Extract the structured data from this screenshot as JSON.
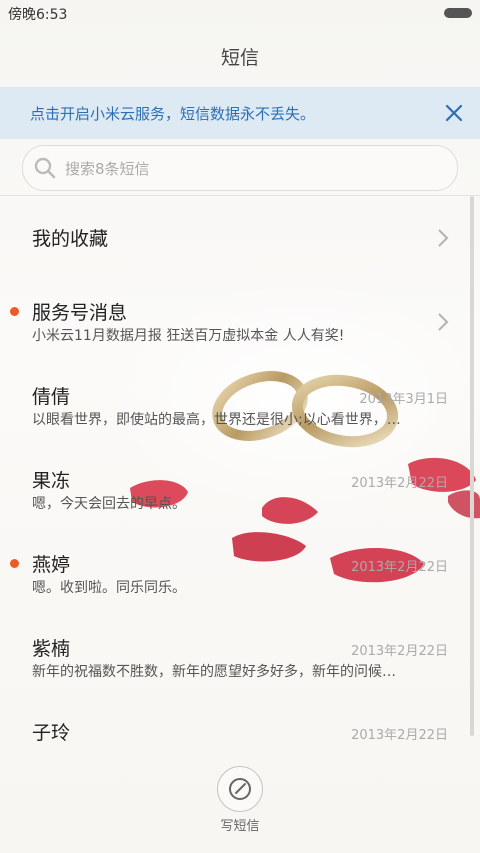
{
  "status_bar": {
    "time": "傍晚6:53"
  },
  "header": {
    "title": "短信"
  },
  "cloud_banner": {
    "text": "点击开启小米云服务，短信数据永不丢失。"
  },
  "search": {
    "placeholder": "搜索8条短信"
  },
  "conversations": [
    {
      "name": "我的收藏",
      "preview": "",
      "date": "",
      "unread": false,
      "chevron": true
    },
    {
      "name": "服务号消息",
      "preview": "小米云11月数据月报 狂送百万虚拟本金 人人有奖!",
      "date": "",
      "unread": true,
      "chevron": true
    },
    {
      "name": "倩倩",
      "preview": "以眼看世界，即使站的最高，世界还是很小;以心看世界，…",
      "date": "2013年3月1日",
      "unread": false,
      "chevron": false
    },
    {
      "name": "果冻",
      "preview": "嗯，今天会回去的早点。",
      "date": "2013年2月22日",
      "unread": false,
      "chevron": false
    },
    {
      "name": "燕婷",
      "preview": "嗯。收到啦。同乐同乐。",
      "date": "2013年2月22日",
      "unread": true,
      "chevron": false
    },
    {
      "name": "紫楠",
      "preview": "新年的祝福数不胜数，新年的愿望好多好多，新年的问候…",
      "date": "2013年2月22日",
      "unread": false,
      "chevron": false
    },
    {
      "name": "子玲",
      "preview": "",
      "date": "2013年2月22日",
      "unread": false,
      "chevron": false
    }
  ],
  "compose": {
    "label": "写短信"
  },
  "colors": {
    "accent": "#2d6fb4",
    "unread_dot": "#ee5a24",
    "banner_bg": "#dde9f3"
  }
}
